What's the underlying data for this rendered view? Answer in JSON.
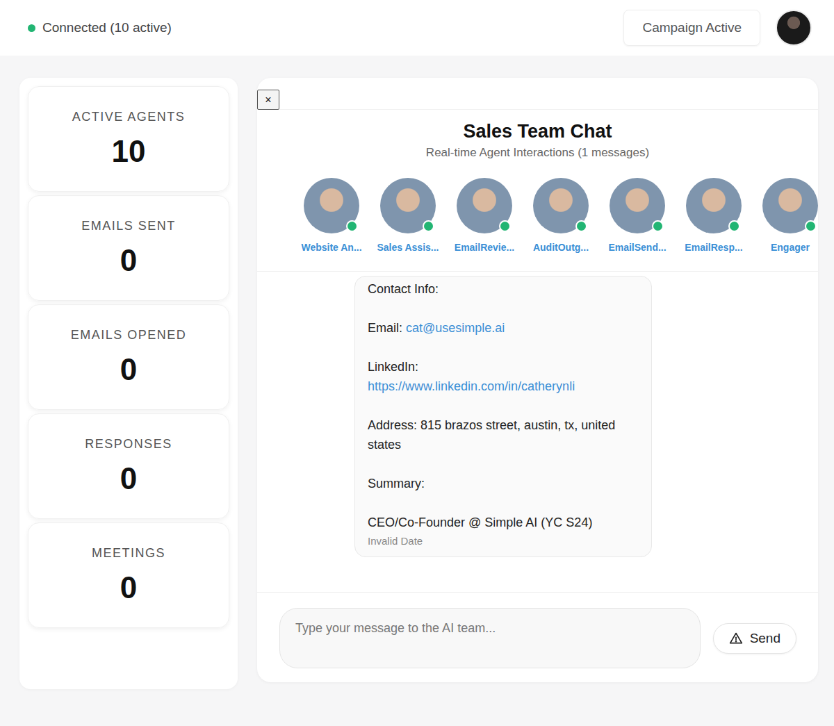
{
  "header": {
    "status": {
      "text": "Connected (10 active)",
      "connected": true
    },
    "campaign_button": "Campaign Active"
  },
  "stats": [
    {
      "label": "ACTIVE AGENTS",
      "value": "10"
    },
    {
      "label": "EMAILS SENT",
      "value": "0"
    },
    {
      "label": "EMAILS OPENED",
      "value": "0"
    },
    {
      "label": "RESPONSES",
      "value": "0"
    },
    {
      "label": "MEETINGS",
      "value": "0"
    }
  ],
  "chat": {
    "close": "×",
    "title": "Sales Team Chat",
    "subtitle": "Real-time Agent Interactions (1 messages)",
    "agents": [
      {
        "name": "Website An...",
        "online": true
      },
      {
        "name": "Sales Assis...",
        "online": true
      },
      {
        "name": "EmailRevie...",
        "online": true
      },
      {
        "name": "AuditOutg...",
        "online": true
      },
      {
        "name": "EmailSend...",
        "online": true
      },
      {
        "name": "EmailResp...",
        "online": true
      },
      {
        "name": "Engager",
        "online": true
      }
    ],
    "message": {
      "sections": [
        {
          "kind": "text",
          "text": "Contact Info:"
        },
        {
          "kind": "inline-link",
          "label": "Email:",
          "link": "cat@usesimple.ai"
        },
        {
          "kind": "block-link",
          "label": "LinkedIn:",
          "link": "https://www.linkedin.com/in/catherynli"
        },
        {
          "kind": "text",
          "text": "Address: 815 brazos street, austin, tx, united states"
        },
        {
          "kind": "text",
          "text": "Summary:"
        },
        {
          "kind": "text",
          "text": "CEO/Co-Founder @ Simple AI (YC S24)"
        }
      ],
      "date": "Invalid Date"
    },
    "input": {
      "placeholder": "Type your message to the AI team..."
    },
    "send": {
      "label": "Send"
    }
  }
}
